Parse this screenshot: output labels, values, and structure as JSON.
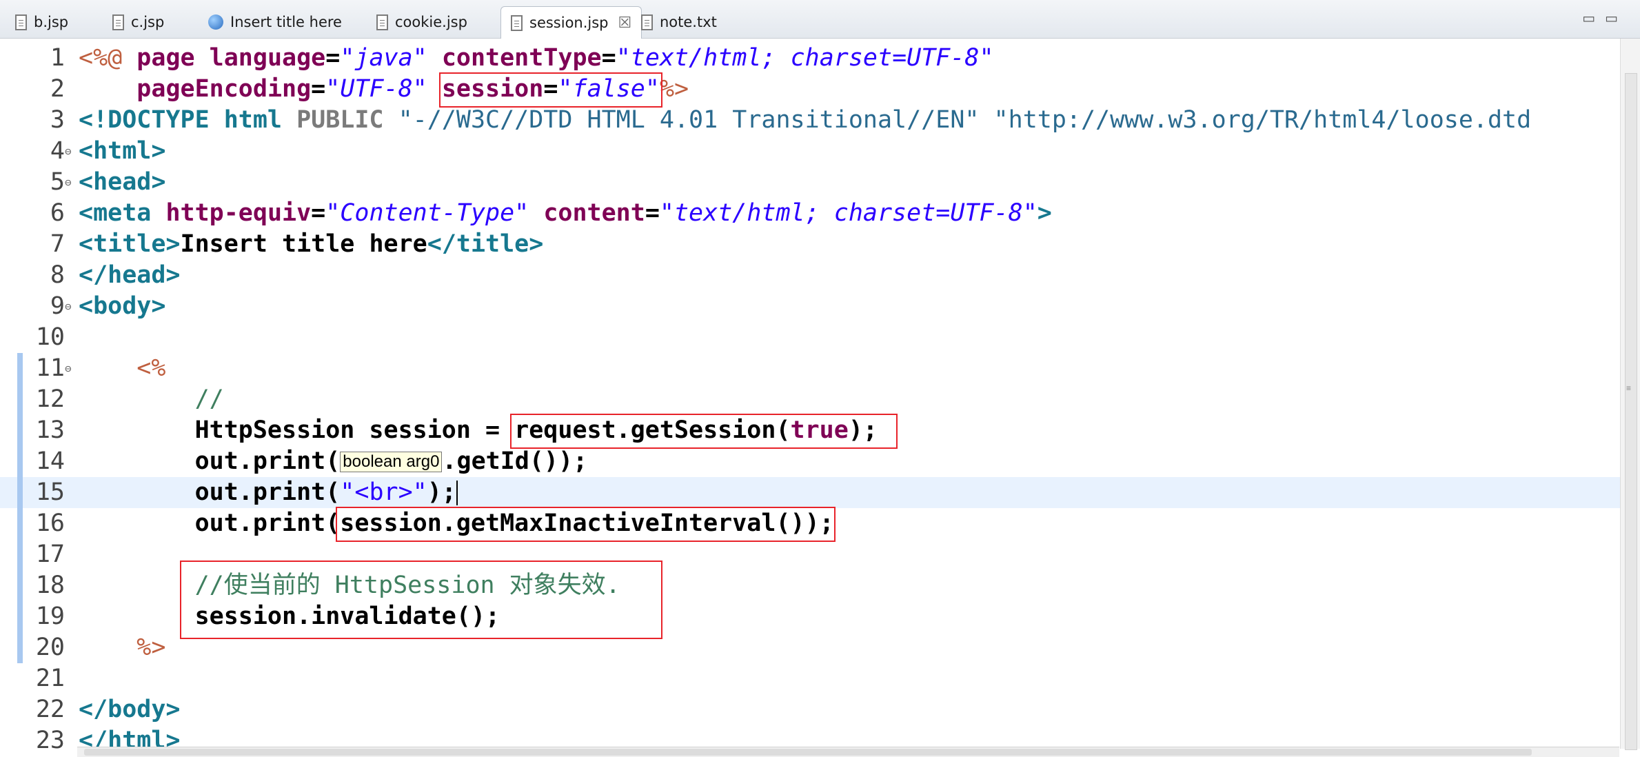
{
  "tabs": [
    {
      "label": "b.jsp",
      "icon": "jsp-file-icon",
      "active": false
    },
    {
      "label": "c.jsp",
      "icon": "jsp-file-icon",
      "active": false
    },
    {
      "label": "Insert title here",
      "icon": "web-browser-icon",
      "active": false
    },
    {
      "label": "cookie.jsp",
      "icon": "jsp-file-icon",
      "active": false
    },
    {
      "label": "session.jsp",
      "icon": "jsp-file-icon",
      "active": true,
      "close": "☒"
    },
    {
      "label": "note.txt",
      "icon": "text-file-icon",
      "active": false
    }
  ],
  "window_controls": {
    "minimize": "▭",
    "maximize": "▭"
  },
  "editor": {
    "line_numbers": [
      "1",
      "2",
      "3",
      "4",
      "5",
      "6",
      "7",
      "8",
      "9",
      "10",
      "11",
      "12",
      "13",
      "14",
      "15",
      "16",
      "17",
      "18",
      "19",
      "20",
      "21",
      "22",
      "23"
    ],
    "fold_marker": "⊖",
    "current_line": 15,
    "tooltip": "boolean arg0",
    "lines": [
      {
        "n": 1,
        "tokens": [
          [
            "jspd",
            "<%@ "
          ],
          [
            "attr",
            "page "
          ],
          [
            "attr",
            "language"
          ],
          [
            "txt",
            "="
          ],
          [
            "val",
            "\"java\" "
          ],
          [
            "attr",
            "contentType"
          ],
          [
            "txt",
            "="
          ],
          [
            "val",
            "\"text/html; charset=UTF-8\""
          ]
        ]
      },
      {
        "n": 2,
        "tokens": [
          [
            "txt",
            "    "
          ],
          [
            "attr",
            "pageEncoding"
          ],
          [
            "txt",
            "="
          ],
          [
            "val",
            "\"UTF-8\" "
          ],
          [
            "attr",
            "session"
          ],
          [
            "txt",
            "="
          ],
          [
            "val",
            "\"false\""
          ],
          [
            "jspd",
            "%>"
          ]
        ]
      },
      {
        "n": 3,
        "tokens": [
          [
            "tag",
            "<!DOCTYPE "
          ],
          [
            "tag",
            "html "
          ],
          [
            "dt",
            "PUBLIC "
          ],
          [
            "str",
            "\"-//W3C//DTD HTML 4.01 Transitional//EN\" "
          ],
          [
            "str",
            "\"http://www.w3.org/TR/html4/loose.dtd"
          ]
        ]
      },
      {
        "n": 4,
        "tokens": [
          [
            "tag",
            "<html>"
          ]
        ]
      },
      {
        "n": 5,
        "tokens": [
          [
            "tag",
            "<head>"
          ]
        ]
      },
      {
        "n": 6,
        "tokens": [
          [
            "tag",
            "<meta "
          ],
          [
            "attr",
            "http-equiv"
          ],
          [
            "txt",
            "="
          ],
          [
            "val",
            "\"Content-Type\" "
          ],
          [
            "attr",
            "content"
          ],
          [
            "txt",
            "="
          ],
          [
            "val",
            "\"text/html; charset=UTF-8\""
          ],
          [
            "tag",
            ">"
          ]
        ]
      },
      {
        "n": 7,
        "tokens": [
          [
            "tag",
            "<title>"
          ],
          [
            "txt",
            "Insert title here"
          ],
          [
            "tag",
            "</title>"
          ]
        ]
      },
      {
        "n": 8,
        "tokens": [
          [
            "tag",
            "</head>"
          ]
        ]
      },
      {
        "n": 9,
        "tokens": [
          [
            "tag",
            "<body>"
          ]
        ]
      },
      {
        "n": 10,
        "tokens": []
      },
      {
        "n": 11,
        "tokens": [
          [
            "txt",
            "    "
          ],
          [
            "jspd",
            "<%"
          ]
        ]
      },
      {
        "n": 12,
        "tokens": [
          [
            "txt",
            "        "
          ],
          [
            "com",
            "//"
          ]
        ]
      },
      {
        "n": 13,
        "tokens": [
          [
            "txt",
            "        HttpSession session = request.getSession("
          ],
          [
            "kw",
            "true"
          ],
          [
            "txt",
            ");"
          ]
        ]
      },
      {
        "n": 14,
        "tokens": [
          [
            "txt",
            "        out.print("
          ],
          [
            "hint",
            ""
          ],
          [
            "txt",
            ".getId());"
          ]
        ]
      },
      {
        "n": 15,
        "tokens": [
          [
            "txt",
            "        out.print("
          ],
          [
            "strq",
            "\"<br>\""
          ],
          [
            "txt",
            ");"
          ],
          [
            "caret",
            ""
          ]
        ]
      },
      {
        "n": 16,
        "tokens": [
          [
            "txt",
            "        out.print(session.getMaxInactiveInterval());"
          ]
        ]
      },
      {
        "n": 17,
        "tokens": []
      },
      {
        "n": 18,
        "tokens": [
          [
            "txt",
            "        "
          ],
          [
            "com",
            "//使当前的 HttpSession 对象失效."
          ]
        ]
      },
      {
        "n": 19,
        "tokens": [
          [
            "txt",
            "        session.invalidate();"
          ]
        ]
      },
      {
        "n": 20,
        "tokens": [
          [
            "txt",
            "    "
          ],
          [
            "jspd",
            "%>"
          ]
        ]
      },
      {
        "n": 21,
        "tokens": []
      },
      {
        "n": 22,
        "tokens": [
          [
            "tag",
            "</body>"
          ]
        ]
      },
      {
        "n": 23,
        "tokens": [
          [
            "tag",
            "</html>"
          ]
        ]
      }
    ]
  },
  "colors": {
    "annotation_box": "#e8232a",
    "current_line": "#e8f2fe"
  }
}
